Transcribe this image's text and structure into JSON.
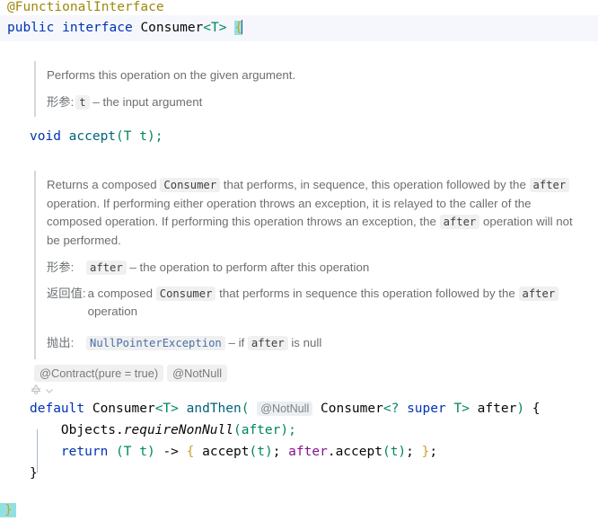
{
  "editor": {
    "language": "java",
    "colors": {
      "keyword": "#0033b3",
      "annotation": "#9e880d",
      "generic": "#008561",
      "method": "#00627a",
      "field": "#871094",
      "doc_text": "#6b6f72",
      "caret_line_bg": "#f5f7fd",
      "brace_match_bg": "#93e0e3",
      "chip_bg": "#f0f0f0",
      "link": "#4a6fa8"
    }
  },
  "code": {
    "line_annotation": "@FunctionalInterface",
    "declaration": {
      "modifier": "public",
      "keyword": "interface",
      "name": "Consumer",
      "generic": "<T>",
      "open_brace": "{"
    },
    "accept_signature": {
      "return_type": "void",
      "name": "accept",
      "params": "(T t);"
    },
    "and_then_signature": {
      "modifier": "default",
      "return_type": "Consumer<T>",
      "name": "andThen",
      "open_paren": "(",
      "inlay_not_null": "@NotNull",
      "param_type": "Consumer<? super T>",
      "param_name": "after",
      "close_paren": ")",
      "open_brace": "{"
    },
    "body_line_1": {
      "receiver": "Objects",
      "dot": ".",
      "method": "requireNonNull",
      "args": "(after);"
    },
    "body_line_2": {
      "keyword": "return",
      "lambda_params": "(T t)",
      "arrow": "->",
      "open_brace": "{",
      "call_1": "accept(t);",
      "receiver": "after",
      "call_2": ".accept(t);",
      "close_brace": "}",
      "semicolon": ";"
    },
    "method_close_brace": "}",
    "class_close_brace": "}"
  },
  "doc_accept": {
    "description": "Performs this operation on the given argument.",
    "params_label": "形参:",
    "param_name": "t",
    "param_dash": "–",
    "param_description": "the input argument"
  },
  "doc_and_then": {
    "paragraph_parts": [
      {
        "type": "text",
        "value": "Returns a composed "
      },
      {
        "type": "code",
        "value": "Consumer"
      },
      {
        "type": "text",
        "value": " that performs, in sequence, this operation followed by the "
      },
      {
        "type": "code",
        "value": "after"
      },
      {
        "type": "text",
        "value": " operation. If performing either operation throws an exception, it is relayed to the caller of the composed operation. If performing this operation throws an exception, the "
      },
      {
        "type": "code",
        "value": "after"
      },
      {
        "type": "text",
        "value": " operation will not be performed."
      }
    ],
    "params_label": "形参:",
    "param_name": "after",
    "param_dash": "–",
    "param_description": "the operation to perform after this operation",
    "returns_label": "返回值:",
    "returns_parts": [
      {
        "type": "text",
        "value": "a composed "
      },
      {
        "type": "code",
        "value": "Consumer"
      },
      {
        "type": "text",
        "value": " that performs in sequence this operation followed by the "
      },
      {
        "type": "code",
        "value": "after"
      },
      {
        "type": "text",
        "value": " operation"
      }
    ],
    "throws_label": "抛出:",
    "throws_type": "NullPointerException",
    "throws_dash": "–",
    "throws_condition_prefix": "if",
    "throws_condition_code": "after",
    "throws_condition_suffix": "is null"
  },
  "inlay_hints": {
    "contract": "@Contract(pure = true)",
    "not_null": "@NotNull"
  },
  "gutter": {
    "marker_name": "implemented-method-marker",
    "chevron": "⌄"
  }
}
